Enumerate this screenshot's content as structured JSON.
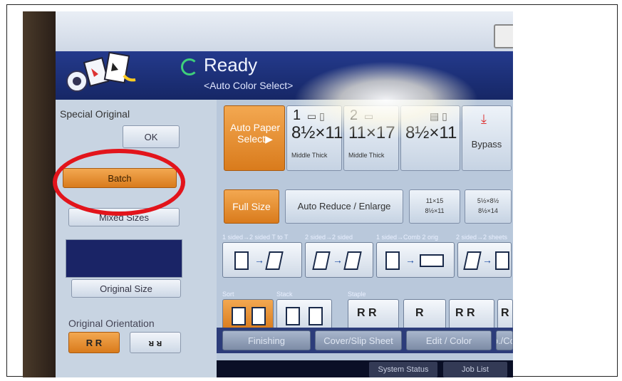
{
  "header": {
    "status": "Ready",
    "mode": "<Auto Color Select>"
  },
  "left_panel": {
    "special_original_label": "Special Original",
    "ok_label": "OK",
    "batch_label": "Batch",
    "mixed_sizes_label": "Mixed Sizes",
    "original_size_label": "Original Size",
    "orientation_label": "Original Orientation"
  },
  "paper": {
    "auto_paper_label": "Auto Paper Select▶",
    "trays": [
      {
        "number": "1",
        "size": "8½×11",
        "sub": "Middle Thick"
      },
      {
        "number": "2",
        "size": "11×17",
        "sub": "Middle Thick"
      },
      {
        "number": "",
        "size": "8½×11",
        "sub": ""
      }
    ],
    "bypass_label": "Bypass"
  },
  "reduce": {
    "full_size_label": "Full Size",
    "auto_reduce_label": "Auto Reduce / Enlarge",
    "ratio1_top": "11×15",
    "ratio1_bottom": "8½×11",
    "ratio2_top": "5½×8½",
    "ratio2_bottom": "8½×14"
  },
  "duplex": {
    "label1": "1 sided→2 sided T to T",
    "label2": "2 sided→2 sided",
    "label3": "1 sided→Comb 2 orig",
    "label4": "2 sided→2 sheets"
  },
  "finish": {
    "sort_label": "Sort",
    "stack_label": "Stack",
    "staple_label": "Staple"
  },
  "bottom_tabs": {
    "finishing": "Finishing",
    "cover": "Cover/Slip Sheet",
    "edit": "Edit / Color",
    "dup": "Dup./Comb"
  },
  "system": {
    "status": "System Status",
    "job_list": "Job List"
  },
  "colors": {
    "accent_orange": "#d97b1c",
    "header_blue": "#243a8c",
    "highlight_red": "#e2141b"
  }
}
